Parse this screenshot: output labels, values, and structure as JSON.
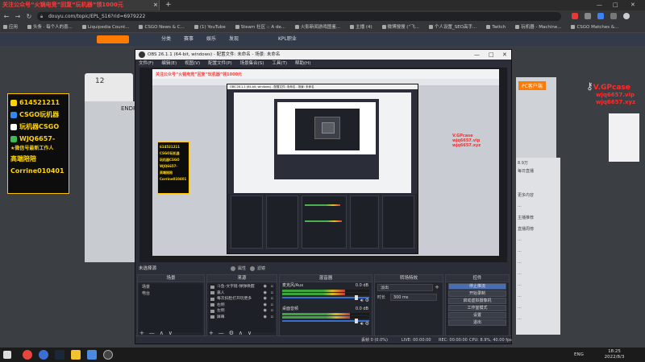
{
  "browser": {
    "tab_title": "关注公众号“火锅电竞”回复“玩机器”领1000元",
    "tab_close": "×",
    "new_tab": "+",
    "url": "douyu.com/topic/EPL_S16?rid=6979222",
    "win_min": "—",
    "win_max": "□",
    "win_close": "✕",
    "bookmarks": [
      "应用",
      "头条 · 每个人的喜...",
      "Liquipedia Count...",
      "CSGO News & C...",
      "(1) YouTube",
      "Steam 社区 :: A de...",
      "火影新闻游戏图鉴...",
      "主播 (4)",
      "微博搜搜 (“飞...",
      "个人设置_SEO高手...",
      "Twitch",
      "玩机器 - Machine...",
      "CSGO Matches &..."
    ]
  },
  "site": {
    "nav_items": [
      "分类",
      "赛事",
      "娱乐",
      "发现",
      "KPL职业"
    ],
    "left_num": "12",
    "left_card_title": "ENDP",
    "right_badge": "PC客户端",
    "rank_lines": [
      "8.9万",
      "每日直播",
      "更多内容",
      "...",
      "主播推荐",
      "直播周榜",
      "...",
      "...",
      "...",
      "...",
      "...",
      "...",
      "...",
      "..."
    ]
  },
  "ad": {
    "qq": "614521211",
    "tw": "CSGO玩机器",
    "tt": "玩机器CSGO",
    "wx": "WJQ6657-",
    "wx_note": "★微信号最新工作人",
    "manager": "高端陪陪",
    "manager_id": "Corrine010401"
  },
  "sponsor": {
    "title": "V.GPcase",
    "line1": "wjq6657.vip",
    "line2": "wjq6657.xyz"
  },
  "obs": {
    "title": "OBS 26.1.1 (64-bit, windows) - 配置文件: 未命名 - 场景: 未命名",
    "menu": [
      "文件(F)",
      "编辑(E)",
      "视图(V)",
      "配置文件(P)",
      "场景集合(S)",
      "工具(T)",
      "帮助(H)"
    ],
    "nested_tab": "关注公众号“火锅电竞”回复“玩机器”领1000元",
    "nested_title": "OBS 26.1.1 (64-bit, windows) - 配置文件: 未命名 - 场景: 未命名",
    "nested_sponsor": [
      "V.GPcase",
      "wjq6657.vip",
      "wjq6657.xyz"
    ],
    "no_source": "未选择源",
    "properties_btn": "属性",
    "filters_btn": "滤镜",
    "docks": {
      "scenes_header": "场景",
      "scenes": [
        "场景",
        "电台"
      ],
      "sources_header": "来源",
      "sources": [
        "斗鱼-文字链-弹弹唤醒",
        "嘉人",
        "每次扣脸打开玩更多",
        "右侧",
        "左侧",
        "屏幕"
      ],
      "mixer_header": "混音器",
      "mixer": [
        {
          "name": "麦克风/Aux",
          "db": "0.0 dB",
          "level": 0.72
        },
        {
          "name": "桌面音频",
          "db": "0.0 dB",
          "level": 0.78
        }
      ],
      "transitions_header": "转场特效",
      "transition": "淡出",
      "duration_label": "时长",
      "duration": "300 ms",
      "controls_header": "控件",
      "controls": [
        "停止推流",
        "开始录制",
        "启动虚拟摄像机",
        "工作室模式",
        "设置",
        "退出"
      ]
    },
    "status": {
      "dropped": "丢帧 0 (0.0%)",
      "live": "LIVE: 00:00:00",
      "rec": "REC: 00:00:00",
      "cpu": "CPU: 8.9%, 40.00 fps"
    },
    "tool_add": "+",
    "tool_remove": "—",
    "tool_up": "∧",
    "tool_down": "∨",
    "tool_gear": "⚙"
  },
  "taskbar": {
    "ime": "ENG",
    "time": "18:25",
    "date": "2022/8/3"
  },
  "colors": {
    "accent_red": "#ff2b2b",
    "ad_yellow": "#ffd400",
    "obs_bg": "#2b2e38"
  }
}
